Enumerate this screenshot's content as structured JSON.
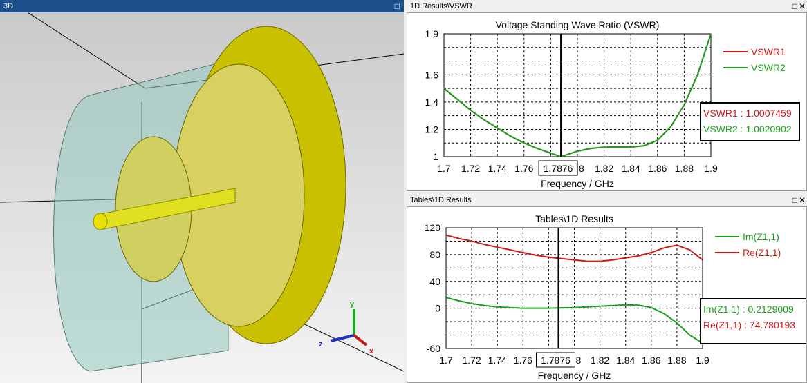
{
  "view3d": {
    "title": "3D",
    "axes": {
      "x": "x",
      "y": "y",
      "z": "z"
    }
  },
  "vswr_panel": {
    "title": "1D Results\\VSWR"
  },
  "z_panel": {
    "title": "Tables\\1D Results"
  },
  "colors": {
    "red": "#d01818",
    "green": "#1aa01a",
    "titlebar": "#1a4f8a"
  },
  "chart_data": [
    {
      "type": "line",
      "title": "Voltage Standing Wave Ratio (VSWR)",
      "xlabel": "Frequency / GHz",
      "ylabel": "",
      "xlim": [
        1.7,
        1.9
      ],
      "ylim": [
        1,
        1.9
      ],
      "xticks": [
        "1.7",
        "1.72",
        "1.74",
        "1.76",
        "1.78",
        "1.8",
        "1.82",
        "1.84",
        "1.86",
        "1.88",
        "1.9"
      ],
      "yticks": [
        {
          "v": 1,
          "label": "1"
        },
        {
          "v": 1.2,
          "label": "1.2"
        },
        {
          "v": 1.4,
          "label": "1.4"
        },
        {
          "v": 1.6,
          "label": "1.6"
        },
        {
          "v": 1.9,
          "label": "1.9"
        }
      ],
      "ygrid_step": 0.1,
      "grid": true,
      "legend": "top-right",
      "marker": {
        "x": 1.7876,
        "label": "1.7876",
        "readouts": [
          "VSWR1 : 1.0007459",
          "VSWR2 : 1.0020902"
        ]
      },
      "x": [
        1.7,
        1.71,
        1.72,
        1.73,
        1.74,
        1.75,
        1.76,
        1.77,
        1.7876,
        1.8,
        1.81,
        1.82,
        1.83,
        1.84,
        1.85,
        1.86,
        1.87,
        1.88,
        1.89,
        1.9
      ],
      "series": [
        {
          "name": "VSWR1",
          "color": "#d01818",
          "values": [
            1.5,
            1.42,
            1.34,
            1.27,
            1.21,
            1.15,
            1.1,
            1.06,
            1.0,
            1.04,
            1.06,
            1.07,
            1.07,
            1.07,
            1.08,
            1.12,
            1.22,
            1.38,
            1.6,
            1.9
          ]
        },
        {
          "name": "VSWR2",
          "color": "#1aa01a",
          "values": [
            1.5,
            1.42,
            1.34,
            1.27,
            1.21,
            1.15,
            1.1,
            1.06,
            1.0,
            1.04,
            1.06,
            1.07,
            1.07,
            1.07,
            1.08,
            1.12,
            1.22,
            1.38,
            1.6,
            1.9
          ]
        }
      ]
    },
    {
      "type": "line",
      "title": "Tables\\1D Results",
      "xlabel": "Frequency / GHz",
      "ylabel": "",
      "xlim": [
        1.7,
        1.9
      ],
      "ylim": [
        -60,
        120
      ],
      "xticks": [
        "1.7",
        "1.72",
        "1.74",
        "1.76",
        "1.78",
        "1.8",
        "1.82",
        "1.84",
        "1.86",
        "1.88",
        "1.9"
      ],
      "yticks": [
        {
          "v": -60,
          "label": "-60"
        },
        {
          "v": 0,
          "label": "0"
        },
        {
          "v": 40,
          "label": "40"
        },
        {
          "v": 80,
          "label": "80"
        },
        {
          "v": 120,
          "label": "120"
        }
      ],
      "ygrid_step": 20,
      "grid": true,
      "legend": "top-right",
      "marker": {
        "x": 1.7876,
        "label": "1.7876",
        "readouts": [
          "Im(Z1,1) : 0.2129009",
          "Re(Z1,1) : 74.780193"
        ]
      },
      "x": [
        1.7,
        1.71,
        1.72,
        1.73,
        1.74,
        1.75,
        1.76,
        1.77,
        1.78,
        1.79,
        1.8,
        1.81,
        1.82,
        1.83,
        1.84,
        1.85,
        1.86,
        1.87,
        1.88,
        1.89,
        1.9
      ],
      "series": [
        {
          "name": "Im(Z1,1)",
          "color": "#1aa01a",
          "values": [
            16,
            11,
            7,
            4,
            2,
            1,
            0,
            0,
            0,
            0.5,
            1,
            2,
            3,
            4,
            5,
            4.5,
            1,
            -8,
            -22,
            -40,
            -52
          ]
        },
        {
          "name": "Re(Z1,1)",
          "color": "#d01818",
          "values": [
            109,
            104,
            100,
            95,
            91,
            87,
            83,
            79,
            76,
            74,
            72,
            70,
            70,
            72,
            75,
            78,
            83,
            90,
            94,
            87,
            72
          ]
        }
      ]
    }
  ]
}
